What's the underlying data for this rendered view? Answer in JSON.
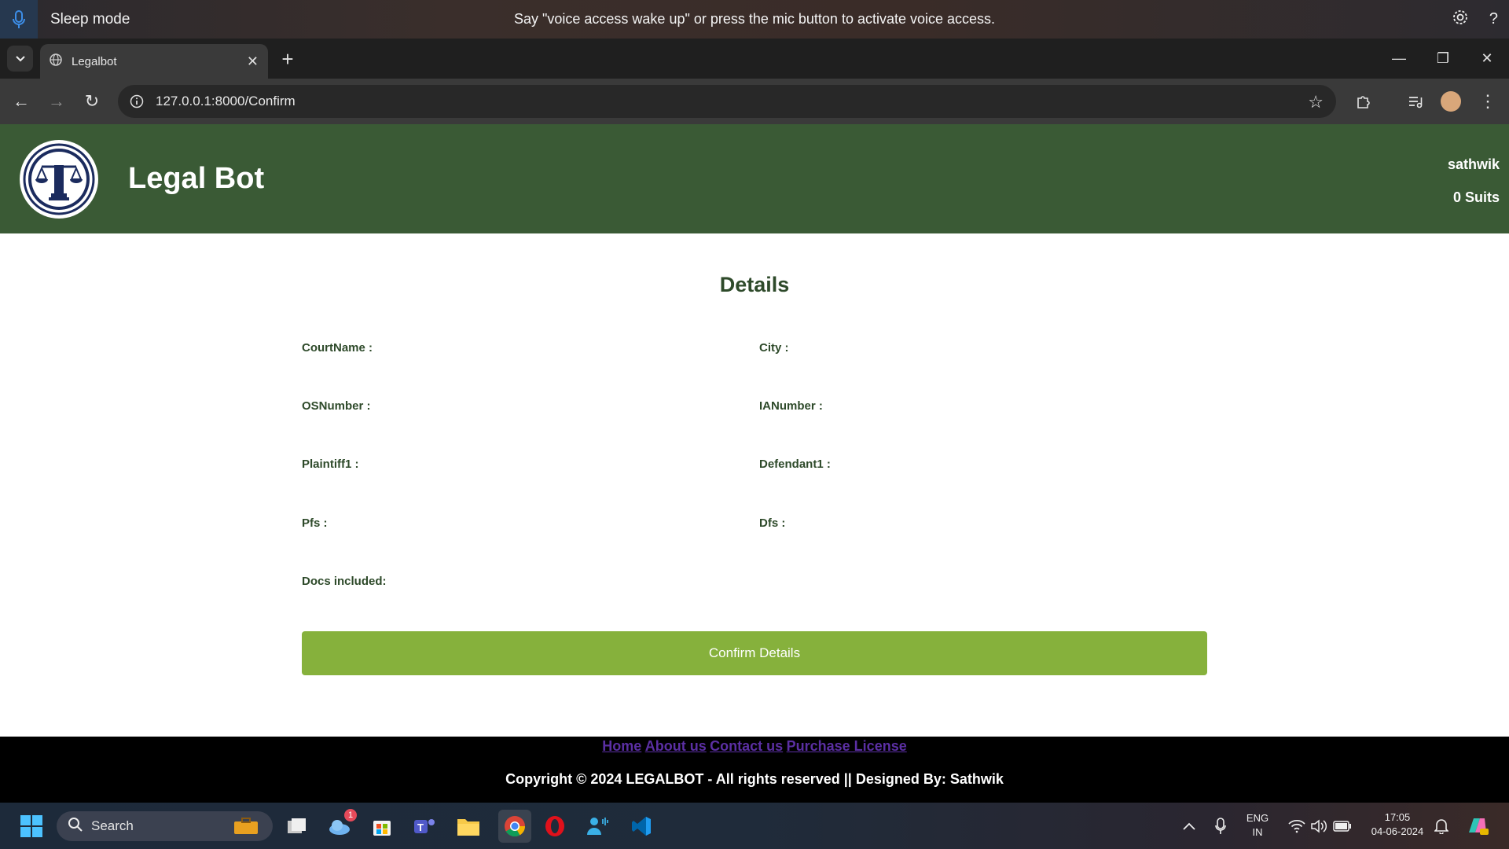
{
  "voice_access": {
    "mode": "Sleep mode",
    "message": "Say \"voice access wake up\" or press the mic button to activate voice access."
  },
  "browser": {
    "tab_title": "Legalbot",
    "url": "127.0.0.1:8000/Confirm"
  },
  "header": {
    "site_title": "Legal Bot",
    "user": "sathwik",
    "suits": "0 Suits"
  },
  "main": {
    "title": "Details",
    "fields": {
      "court_name": "CourtName :",
      "city": "City :",
      "os_number": "OSNumber :",
      "ia_number": "IANumber :",
      "plaintiff1": "Plaintiff1 :",
      "defendant1": "Defendant1 :",
      "pfs": "Pfs :",
      "dfs": "Dfs :",
      "docs": "Docs included:"
    },
    "confirm_label": "Confirm Details"
  },
  "footer": {
    "links": [
      "Home",
      "About us",
      "Contact us",
      "Purchase License"
    ],
    "copyright": "Copyright © 2024 LEGALBOT - All rights reserved || Designed By: Sathwik"
  },
  "taskbar": {
    "search_label": "Search",
    "weather_badge": "1",
    "lang_top": "ENG",
    "lang_bottom": "IN",
    "time": "17:05",
    "date": "04-06-2024"
  },
  "colors": {
    "header_green": "#3a5a35",
    "button_green": "#86b13c",
    "link_purple": "#5b2fa3"
  }
}
